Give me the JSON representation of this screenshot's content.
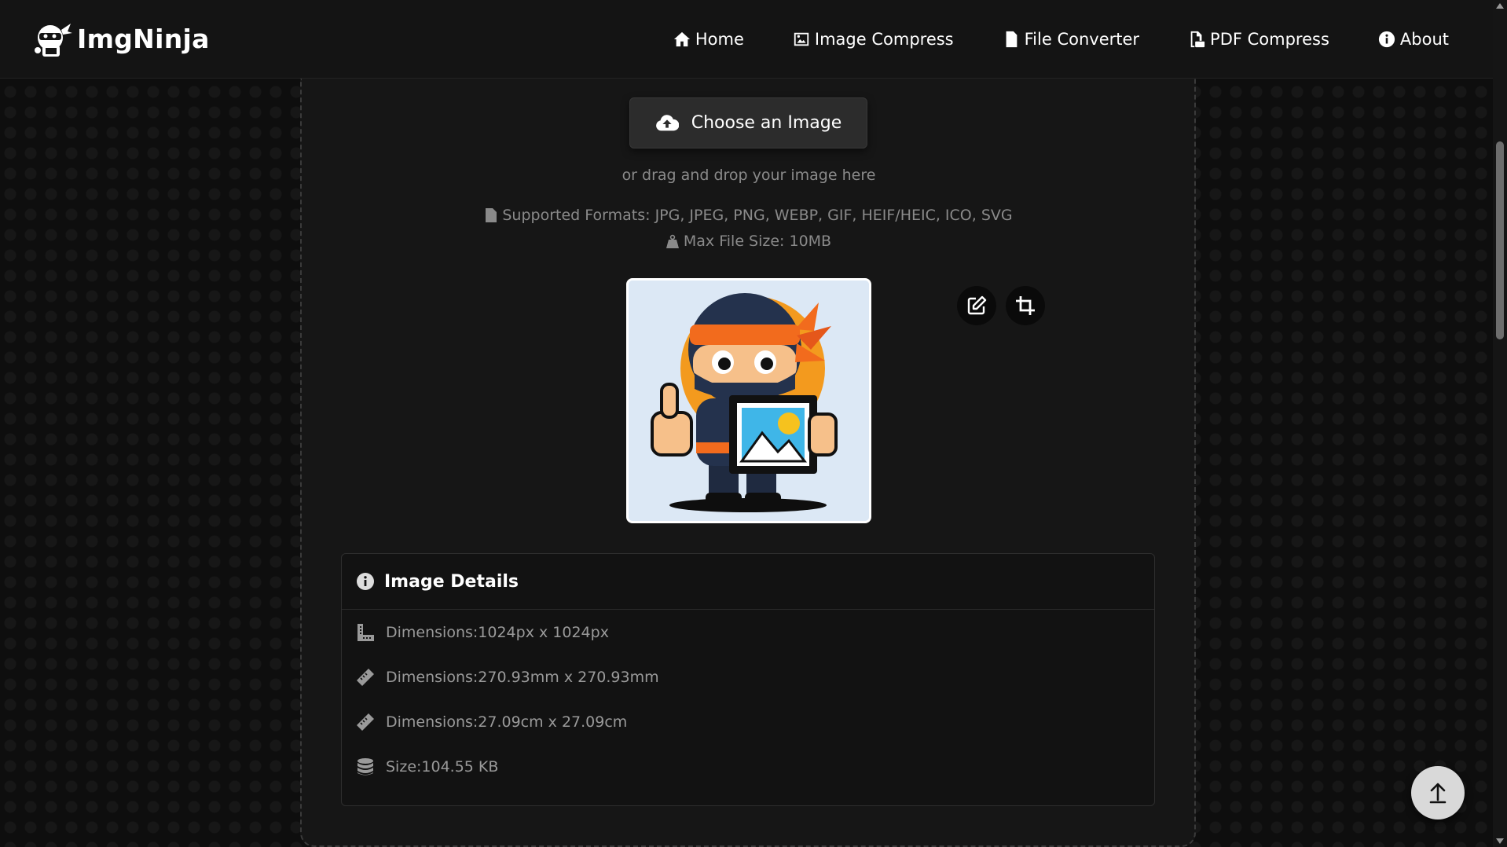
{
  "brand": {
    "name": "ImgNinja",
    "logo_icon": "ninja-logo-icon"
  },
  "nav": [
    {
      "label": "Home",
      "icon": "home-icon"
    },
    {
      "label": "Image Compress",
      "icon": "image-icon"
    },
    {
      "label": "File Converter",
      "icon": "file-icon"
    },
    {
      "label": "PDF Compress",
      "icon": "pdf-file-icon"
    },
    {
      "label": "About",
      "icon": "info-icon"
    }
  ],
  "upload": {
    "button_label": "Choose an Image",
    "button_icon": "cloud-upload-icon",
    "drag_text": "or drag and drop your image here",
    "formats": "Supported Formats: JPG, JPEG, PNG, WEBP, GIF, HEIF/HEIC, ICO, SVG",
    "max_size": "Max File Size: 10MB"
  },
  "tools": {
    "edit_icon": "edit-icon",
    "crop_icon": "crop-icon"
  },
  "details": {
    "title": "Image Details",
    "rows": [
      {
        "icon": "ruler-combined-icon",
        "text": "Dimensions:1024px x 1024px"
      },
      {
        "icon": "ruler-icon",
        "text": "Dimensions:270.93mm x 270.93mm"
      },
      {
        "icon": "ruler-icon",
        "text": "Dimensions:27.09cm x 27.09cm"
      },
      {
        "icon": "database-icon",
        "text": "Size:104.55 KB"
      }
    ]
  },
  "colors": {
    "background": "#0e0e0e",
    "header": "#141414",
    "panel": "#161616",
    "button": "#2c2c2c",
    "muted_text": "#8a8a8a"
  }
}
